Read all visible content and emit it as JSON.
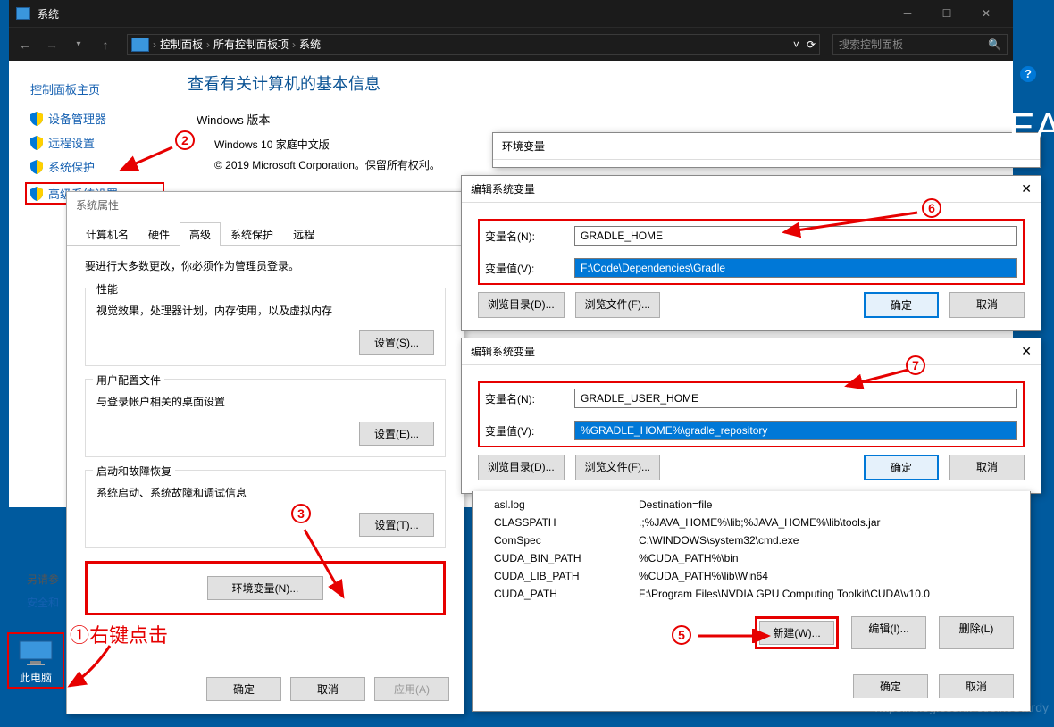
{
  "window": {
    "title": "系统"
  },
  "toolbar": {
    "breadcrumb": [
      "控制面板",
      "所有控制面板项",
      "系统"
    ],
    "search_placeholder": "搜索控制面板"
  },
  "left_nav": {
    "header": "控制面板主页",
    "items": [
      "设备管理器",
      "远程设置",
      "系统保护",
      "高级系统设置"
    ]
  },
  "side_labels": {
    "l1": "另请参",
    "l2": "安全和"
  },
  "system_main": {
    "heading": "查看有关计算机的基本信息",
    "sub": "Windows 版本",
    "version": "Windows 10 家庭中文版",
    "copyright": "© 2019 Microsoft Corporation。保留所有权利。"
  },
  "props": {
    "title": "系统属性",
    "tabs": [
      "计算机名",
      "硬件",
      "高级",
      "系统保护",
      "远程"
    ],
    "active_tab": 2,
    "note": "要进行大多数更改，你必须作为管理员登录。",
    "groups": [
      {
        "legend": "性能",
        "desc": "视觉效果，处理器计划，内存使用，以及虚拟内存",
        "btn": "设置(S)..."
      },
      {
        "legend": "用户配置文件",
        "desc": "与登录帐户相关的桌面设置",
        "btn": "设置(E)..."
      },
      {
        "legend": "启动和故障恢复",
        "desc": "系统启动、系统故障和调试信息",
        "btn": "设置(T)..."
      }
    ],
    "env_btn": "环境变量(N)...",
    "bottom": [
      "确定",
      "取消",
      "应用(A)"
    ]
  },
  "env_win": {
    "title": "环境变量"
  },
  "edit_dlg": {
    "title": "编辑系统变量",
    "name_label": "变量名(N):",
    "value_label": "变量值(V):",
    "browse_dir": "浏览目录(D)...",
    "browse_file": "浏览文件(F)...",
    "ok": "确定",
    "cancel": "取消"
  },
  "var1": {
    "name": "GRADLE_HOME",
    "value": "F:\\Code\\Dependencies\\Gradle"
  },
  "var2": {
    "name": "GRADLE_USER_HOME",
    "value": "%GRADLE_HOME%\\gradle_repository"
  },
  "sysvars": [
    {
      "name": "asl.log",
      "value": "Destination=file"
    },
    {
      "name": "CLASSPATH",
      "value": ".;%JAVA_HOME%\\lib;%JAVA_HOME%\\lib\\tools.jar"
    },
    {
      "name": "ComSpec",
      "value": "C:\\WINDOWS\\system32\\cmd.exe"
    },
    {
      "name": "CUDA_BIN_PATH",
      "value": "%CUDA_PATH%\\bin"
    },
    {
      "name": "CUDA_LIB_PATH",
      "value": "%CUDA_PATH%\\lib\\Win64"
    },
    {
      "name": "CUDA_PATH",
      "value": "F:\\Program Files\\NVDIA GPU Computing Toolkit\\CUDA\\v10.0"
    }
  ],
  "list_btns": {
    "new": "新建(W)...",
    "edit": "编辑(I)...",
    "delete": "删除(L)"
  },
  "desktop": {
    "label": "此电脑"
  },
  "annotations": {
    "a1": "①右键点击",
    "a2": "②",
    "a3": "③",
    "a5": "⑤",
    "a6": "⑥",
    "a7": "⑦"
  },
  "watermark": "https://blog.csdn.net/JikeStardy",
  "ea": "EA"
}
